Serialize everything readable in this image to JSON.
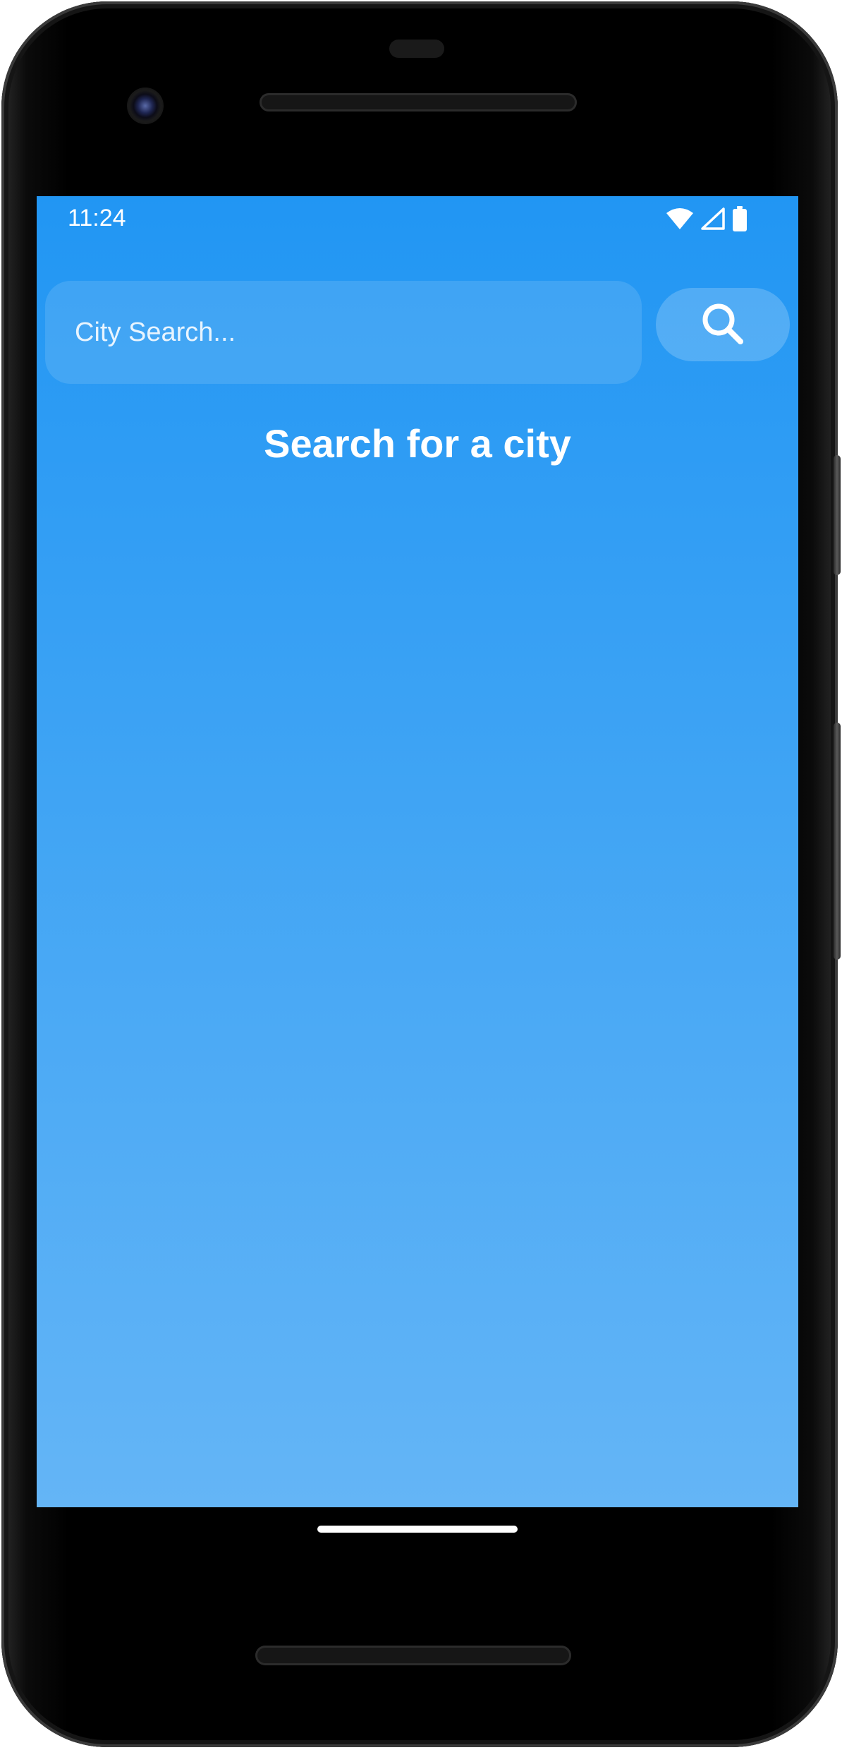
{
  "status_bar": {
    "time": "11:24",
    "icons": [
      "wifi-icon",
      "cellular-signal-icon",
      "battery-icon"
    ]
  },
  "search": {
    "placeholder": "City Search...",
    "value": "",
    "button_icon": "search-icon"
  },
  "main": {
    "empty_state_title": "Search for a city"
  },
  "colors": {
    "gradient_top": "#2196f3",
    "gradient_bottom": "#64b5f6",
    "text": "#ffffff"
  }
}
